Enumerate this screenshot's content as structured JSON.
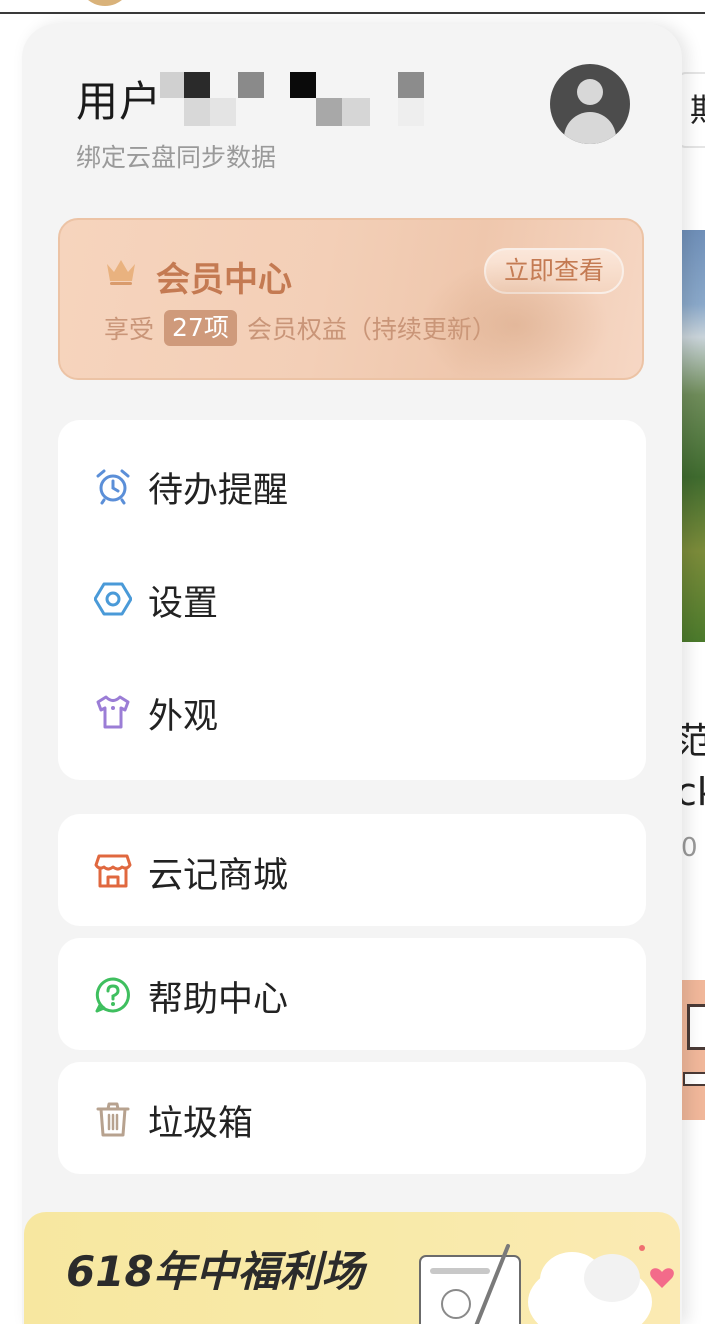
{
  "user": {
    "name_visible": "用户",
    "subtitle": "绑定云盘同步数据"
  },
  "vip": {
    "title": "会员中心",
    "subtitle_pre": "享受",
    "count": "27项",
    "subtitle_post": "会员权益（持续更新）",
    "button": "立即查看"
  },
  "menu": {
    "group1": [
      {
        "label": "待办提醒",
        "icon": "alarm-clock-icon"
      },
      {
        "label": "设置",
        "icon": "settings-hexagon-icon"
      },
      {
        "label": "外观",
        "icon": "t-shirt-icon"
      }
    ],
    "store": {
      "label": "云记商城",
      "icon": "store-icon"
    },
    "help": {
      "label": "帮助中心",
      "icon": "help-question-icon"
    },
    "trash": {
      "label": "垃圾箱",
      "icon": "trash-icon"
    }
  },
  "banner": {
    "text": "618年中福利场"
  },
  "background": {
    "search_char": "期",
    "text_a": "范",
    "text_b": "ck",
    "text_c": "0"
  },
  "colors": {
    "drawer_bg": "#f4f4f4",
    "vip_accent": "#c47a52",
    "alarm_icon": "#5b8fd8",
    "settings_icon": "#4a9ad8",
    "shirt_icon": "#9b7dd6",
    "store_icon": "#e0683f",
    "help_icon": "#3fbf5f",
    "trash_icon": "#b7a28f"
  }
}
